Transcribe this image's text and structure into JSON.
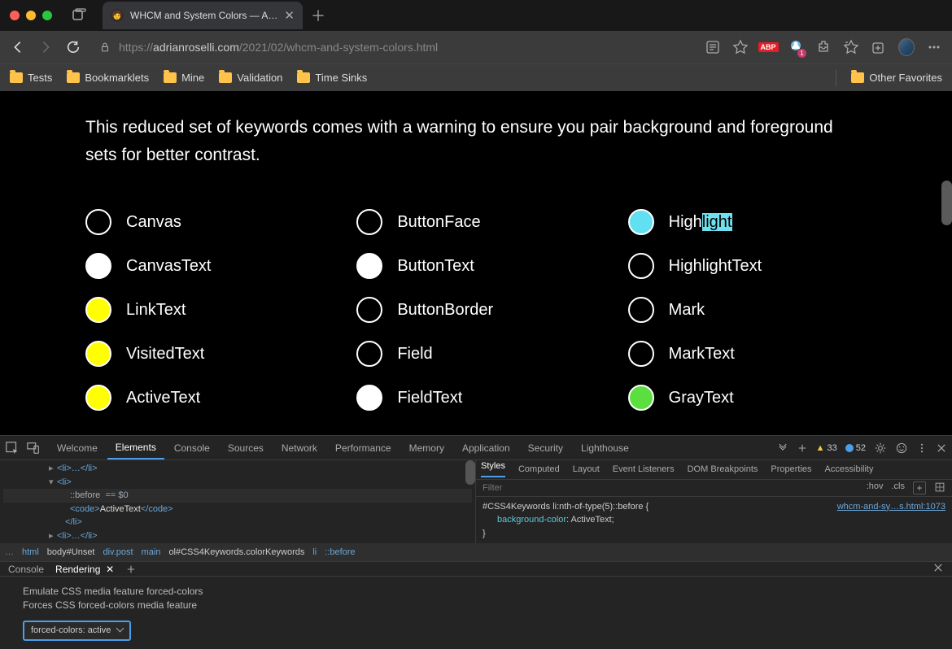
{
  "titlebar": {
    "tab_title": "WHCM and System Colors — A…"
  },
  "toolbar": {
    "url_host": "adrianroselli.com",
    "url_path": "/2021/02/whcm-and-system-colors.html",
    "abp": "ABP",
    "notif_count": "1"
  },
  "bookmarks": {
    "items": [
      "Tests",
      "Bookmarklets",
      "Mine",
      "Validation",
      "Time Sinks"
    ],
    "other": "Other Favorites"
  },
  "page": {
    "paragraph": "This reduced set of keywords comes with a warning to ensure you pair background and foreground sets for better contrast.",
    "swatches": [
      {
        "label": "Canvas",
        "class": "c-black"
      },
      {
        "label": "ButtonFace",
        "class": "c-black"
      },
      {
        "label": "High",
        "class": "c-cyan",
        "suffix_hl": "light"
      },
      {
        "label": "CanvasText",
        "class": "c-white"
      },
      {
        "label": "ButtonText",
        "class": "c-white"
      },
      {
        "label": "HighlightText",
        "class": "c-black"
      },
      {
        "label": "LinkText",
        "class": "c-yellow"
      },
      {
        "label": "ButtonBorder",
        "class": "c-black"
      },
      {
        "label": "Mark",
        "class": "c-black"
      },
      {
        "label": "VisitedText",
        "class": "c-yellow"
      },
      {
        "label": "Field",
        "class": "c-black"
      },
      {
        "label": "MarkText",
        "class": "c-black"
      },
      {
        "label": "ActiveText",
        "class": "c-yellow"
      },
      {
        "label": "FieldText",
        "class": "c-white"
      },
      {
        "label": "GrayText",
        "class": "c-green"
      }
    ]
  },
  "devtools": {
    "tabs": [
      "Welcome",
      "Elements",
      "Console",
      "Sources",
      "Network",
      "Performance",
      "Memory",
      "Application",
      "Security",
      "Lighthouse"
    ],
    "warn_count": "33",
    "info_count": "52",
    "elements": {
      "pseudo": "::before",
      "sel0": "== $0",
      "active_text": "ActiveText",
      "li_open": "<li>",
      "li_close": "</li>",
      "li_coll": "<li>…</li>",
      "code_open": "<code>",
      "code_close": "</code>"
    },
    "breadcrumb": [
      "html",
      "body#Unset",
      "div.post",
      "main",
      "ol#CSS4Keywords.colorKeywords",
      "li",
      "::before"
    ],
    "styles": {
      "tabs": [
        "Styles",
        "Computed",
        "Layout",
        "Event Listeners",
        "DOM Breakpoints",
        "Properties",
        "Accessibility"
      ],
      "filter_placeholder": "Filter",
      "hov": ":hov",
      "cls": ".cls",
      "selector": "#CSS4Keywords li:nth-of-type(5)::before {",
      "link": "whcm-and-sy…s.html:1073",
      "prop_name": "background-color",
      "prop_val": ": ActiveText;",
      "close": "}"
    }
  },
  "drawer": {
    "tabs": [
      "Console",
      "Rendering"
    ],
    "title": "Emulate CSS media feature forced-colors",
    "desc": "Forces CSS forced-colors media feature",
    "select_val": "forced-colors: active"
  }
}
